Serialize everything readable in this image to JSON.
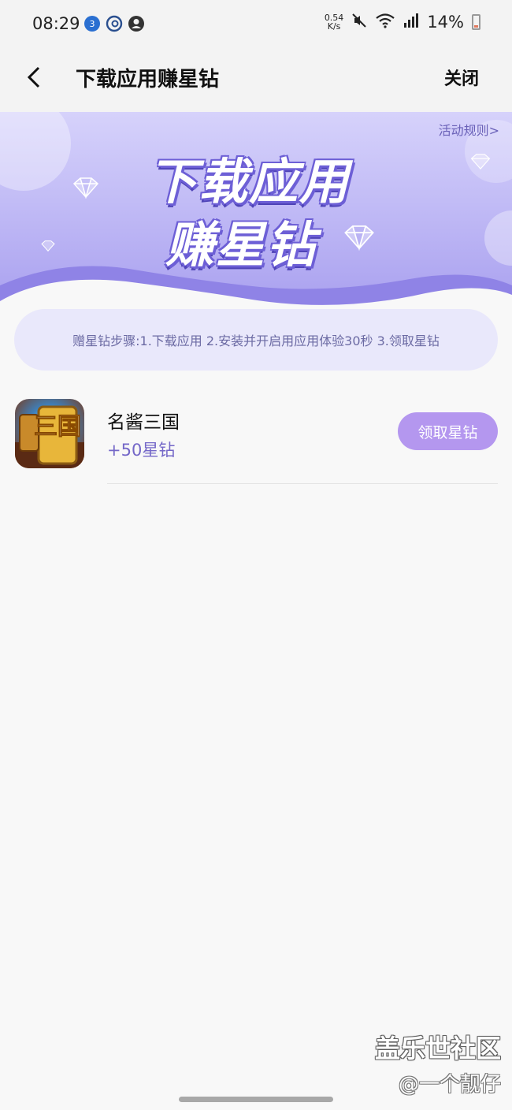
{
  "status_bar": {
    "time": "08:29",
    "net_speed_value": "0.54",
    "net_speed_unit": "K/s",
    "battery_percent": "14%"
  },
  "header": {
    "title": "下载应用赚星钻",
    "close_label": "关闭"
  },
  "banner": {
    "rules_link": "活动规则>",
    "headline_line1": "下载应用",
    "headline_line2": "赚星钻"
  },
  "steps_text": "赠星钻步骤:1.下载应用 2.安装并开启用应用体验30秒 3.领取星钻",
  "apps": [
    {
      "name": "名酱三国",
      "reward": "+50星钻",
      "button_label": "领取星钻",
      "icon_glyph": "三国"
    }
  ],
  "watermark": {
    "line1": "盖乐世社区",
    "line2": "@一个靓仔"
  },
  "colors": {
    "accent": "#7467c8",
    "button": "#b497ef",
    "steps_bg": "#e9e8fb"
  }
}
